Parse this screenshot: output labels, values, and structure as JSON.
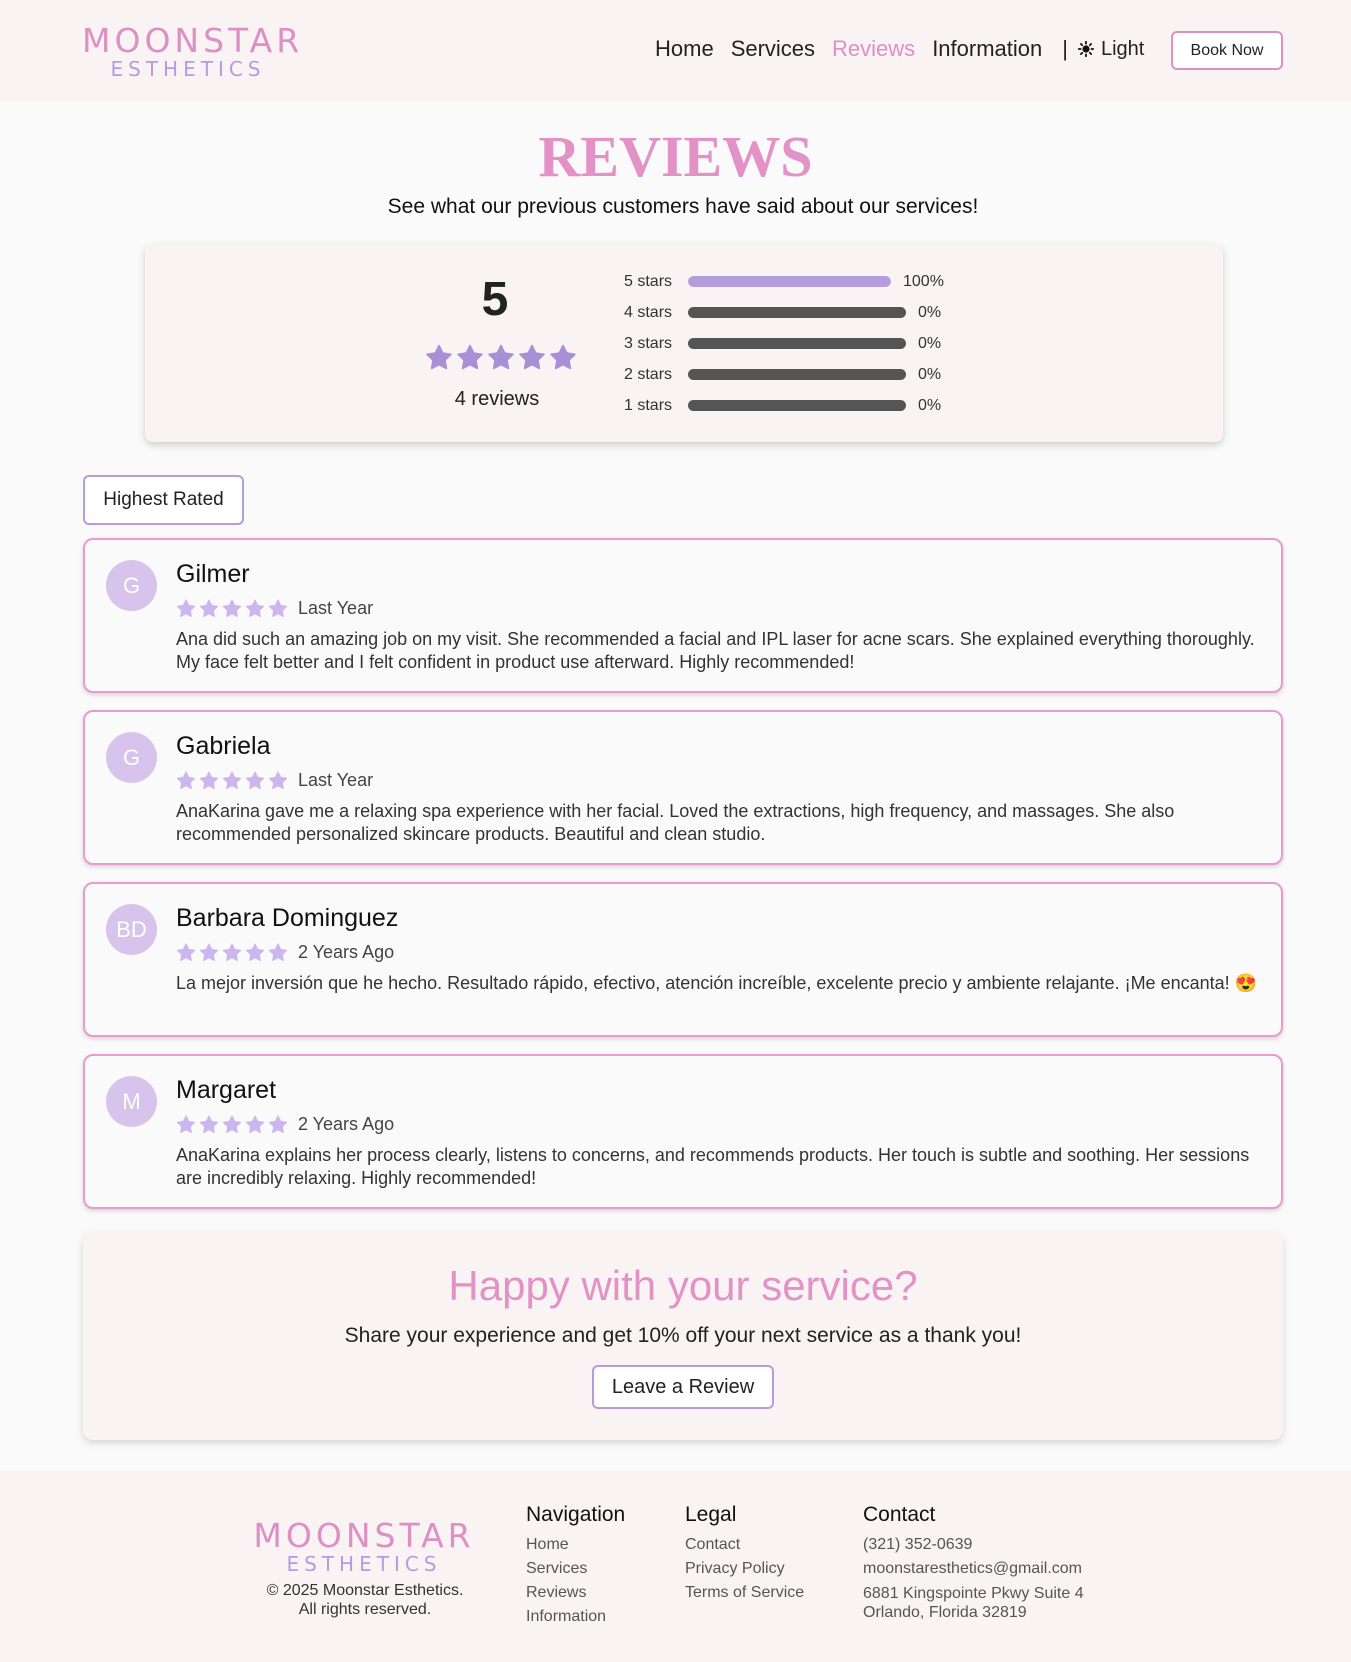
{
  "brand": {
    "line1": "MOONSTAR",
    "line2": "ESTHETICS"
  },
  "nav": {
    "items": [
      {
        "label": "Home",
        "active": false
      },
      {
        "label": "Services",
        "active": false
      },
      {
        "label": "Reviews",
        "active": true
      },
      {
        "label": "Information",
        "active": false
      }
    ],
    "separator": "|",
    "theme_label": "Light",
    "theme_icon": "sun-icon",
    "book_label": "Book Now"
  },
  "page": {
    "title": "REVIEWS",
    "subtitle": "See what our previous customers have said about our services!"
  },
  "summary": {
    "average": "5",
    "rating_stars": 5,
    "count_label": "4 reviews",
    "breakdown": [
      {
        "label": "5 stars",
        "percent": 100,
        "percent_label": "100%"
      },
      {
        "label": "4 stars",
        "percent": 0,
        "percent_label": "0%"
      },
      {
        "label": "3 stars",
        "percent": 0,
        "percent_label": "0%"
      },
      {
        "label": "2 stars",
        "percent": 0,
        "percent_label": "0%"
      },
      {
        "label": "1 stars",
        "percent": 0,
        "percent_label": "0%"
      }
    ]
  },
  "filter": {
    "label": "Highest Rated"
  },
  "reviews": [
    {
      "initials": "G",
      "name": "Gilmer",
      "stars": 5,
      "date": "Last Year",
      "text": "Ana did such an amazing job on my visit. She recommended a facial and IPL laser for acne scars. She explained everything thoroughly. My face felt better and I felt confident in product use afterward. Highly recommended!"
    },
    {
      "initials": "G",
      "name": "Gabriela",
      "stars": 5,
      "date": "Last Year",
      "text": "AnaKarina gave me a relaxing spa experience with her facial. Loved the extractions, high frequency, and massages. She also recommended personalized skincare products. Beautiful and clean studio."
    },
    {
      "initials": "BD",
      "name": "Barbara Dominguez",
      "stars": 5,
      "date": "2 Years Ago",
      "text": "La mejor inversión que he hecho. Resultado rápido, efectivo, atención increíble, excelente precio y ambiente relajante. ¡Me encanta! 😍"
    },
    {
      "initials": "M",
      "name": "Margaret",
      "stars": 5,
      "date": "2 Years Ago",
      "text": "AnaKarina explains her process clearly, listens to concerns, and recommends products. Her touch is subtle and soothing. Her sessions are incredibly relaxing. Highly recommended!"
    }
  ],
  "cta": {
    "title": "Happy with your service?",
    "text": "Share your experience and get 10% off your next service as a thank you!",
    "button": "Leave a Review"
  },
  "footer": {
    "copyright_line1": "© 2025 Moonstar Esthetics.",
    "copyright_line2": "All rights reserved.",
    "navigation": {
      "heading": "Navigation",
      "links": [
        "Home",
        "Services",
        "Reviews",
        "Information"
      ]
    },
    "legal": {
      "heading": "Legal",
      "links": [
        "Contact",
        "Privacy Policy",
        "Terms of Service"
      ]
    },
    "contact": {
      "heading": "Contact",
      "phone": "(321) 352-0639",
      "email": "moonstaresthetics@gmail.com",
      "address_line1": "6881 Kingspointe Pkwy Suite 4",
      "address_line2": "Orlando, Florida 32819"
    }
  },
  "colors": {
    "brand_pink": "#dd8fc6",
    "brand_purple": "#b79be0",
    "star_big": "#a98fd6",
    "star_small": "#cdb6ee",
    "bar_fill": "#b39ddb",
    "bar_track": "#555555"
  }
}
